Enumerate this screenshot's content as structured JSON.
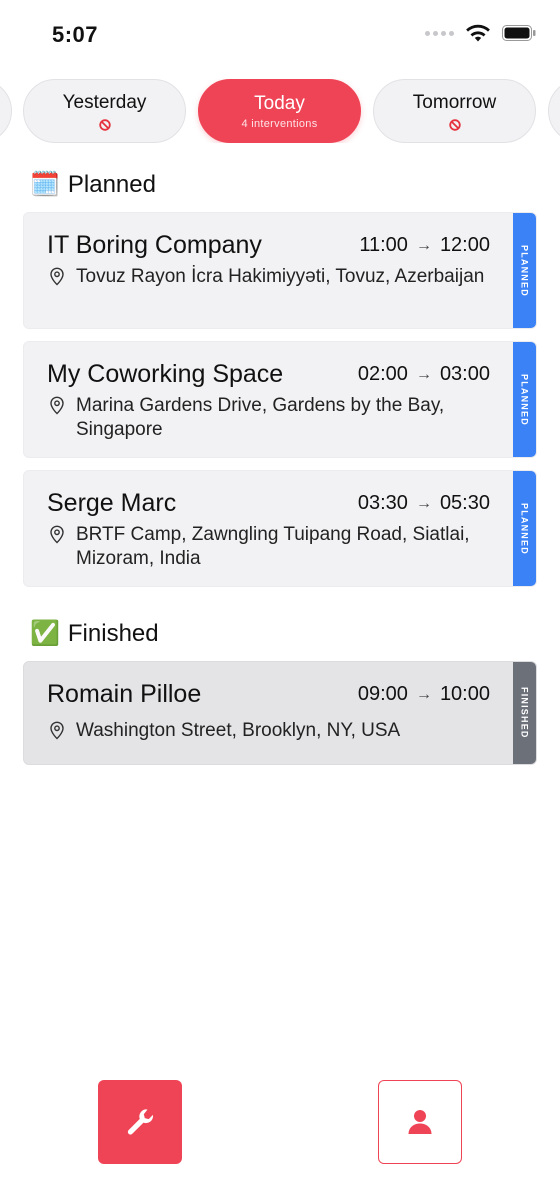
{
  "status_bar": {
    "time": "5:07"
  },
  "days": [
    {
      "label": "Yesterday",
      "sub": "",
      "active": false
    },
    {
      "label": "Today",
      "sub": "4 interventions",
      "active": true
    },
    {
      "label": "Tomorrow",
      "sub": "",
      "active": false
    }
  ],
  "sections": {
    "planned": {
      "emoji": "🗓️",
      "title": "Planned"
    },
    "finished": {
      "emoji": "✅",
      "title": "Finished"
    }
  },
  "planned_items": [
    {
      "name": "IT Boring Company",
      "start": "11:00",
      "end": "12:00",
      "address": "Tovuz Rayon İcra Hakimiyyəti, Tovuz, Azerbaijan",
      "status": "PLANNED"
    },
    {
      "name": "My Coworking Space",
      "start": "02:00",
      "end": "03:00",
      "address": "Marina Gardens Drive, Gardens by the Bay, Singapore",
      "status": "PLANNED"
    },
    {
      "name": "Serge Marc",
      "start": "03:30",
      "end": "05:30",
      "address": "BRTF Camp, Zawngling Tuipang Road, Siatlai, Mizoram, India",
      "status": "PLANNED"
    }
  ],
  "finished_items": [
    {
      "name": "Romain Pilloe",
      "start": "09:00",
      "end": "10:00",
      "address": "Washington Street, Brooklyn, NY, USA",
      "status": "FINISHED"
    }
  ],
  "colors": {
    "accent": "#ef4456",
    "planned": "#3b82f6",
    "finished": "#6b7079"
  },
  "icons": {
    "tab_interventions": "wrench-icon",
    "tab_profile": "user-icon"
  }
}
